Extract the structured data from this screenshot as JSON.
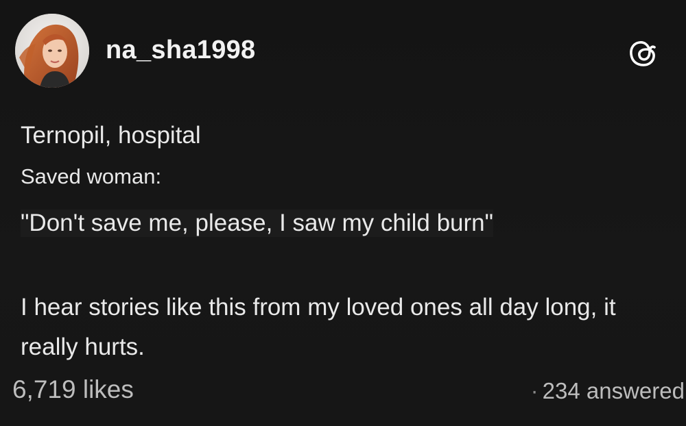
{
  "post": {
    "username": "na_sha1998",
    "avatar_icon": "profile-photo-woman-red-hair",
    "brand_icon": "threads-logo-icon",
    "lines": [
      "Ternopil, hospital",
      "Saved woman:",
      "\"Don't save me, please, I saw my child burn\""
    ],
    "paragraph": "I hear stories like this from my loved ones all day long, it really hurts.",
    "likes": "6,719 likes",
    "answers": "234 answered",
    "separator": "·"
  },
  "colors": {
    "background": "#151515",
    "text": "#e9e9e9",
    "muted": "#bdbdbd"
  }
}
